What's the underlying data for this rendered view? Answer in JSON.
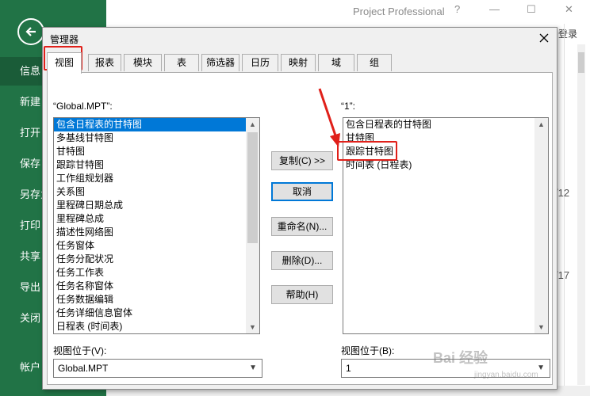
{
  "app": {
    "title": "Project Professional",
    "help_label": "?",
    "minimize_label": "—",
    "maximize_label": "☐",
    "close_label": "✕",
    "login_label": "登录"
  },
  "backstage": {
    "items": [
      {
        "label": "信息"
      },
      {
        "label": "新建"
      },
      {
        "label": "打开"
      },
      {
        "label": "保存"
      },
      {
        "label": "另存为"
      },
      {
        "label": "打印"
      },
      {
        "label": "共享"
      },
      {
        "label": "导出"
      },
      {
        "label": "关闭"
      },
      {
        "label": "帐户"
      }
    ]
  },
  "background_dates": {
    "date1": "/12",
    "date2": "/17"
  },
  "dialog": {
    "title": "管理器",
    "tabs": [
      "视图",
      "报表",
      "模块",
      "表",
      "筛选器",
      "日历",
      "映射",
      "域",
      "组"
    ],
    "left_label": "“Global.MPT”:",
    "left_items": [
      "包含日程表的甘特图",
      "多基线甘特图",
      "甘特图",
      "跟踪甘特图",
      "工作组规划器",
      "关系图",
      "里程碑日期总成",
      "里程碑总成",
      "描述性网络图",
      "任务窗体",
      "任务分配状况",
      "任务工作表",
      "任务名称窗体",
      "任务数据编辑",
      "任务详细信息窗体",
      "日程表 (时间表)"
    ],
    "right_label": "“1”:",
    "right_items": [
      "包含日程表的甘特图",
      "甘特图",
      "跟踪甘特图",
      "时间表 (日程表)"
    ],
    "buttons": {
      "copy": "复制(C) >>",
      "cancel": "取消",
      "rename": "重命名(N)...",
      "delete": "删除(D)...",
      "help": "帮助(H)"
    },
    "left_combo_label": "视图位于(V):",
    "left_combo_value": "Global.MPT",
    "right_combo_label": "视图位于(B):",
    "right_combo_value": "1"
  },
  "watermark": {
    "text": "Bai 经验",
    "sub": "jingyan.baidu.com"
  },
  "colors": {
    "backstage": "#217346",
    "selection": "#0078d7",
    "annotation": "#e0201a"
  }
}
